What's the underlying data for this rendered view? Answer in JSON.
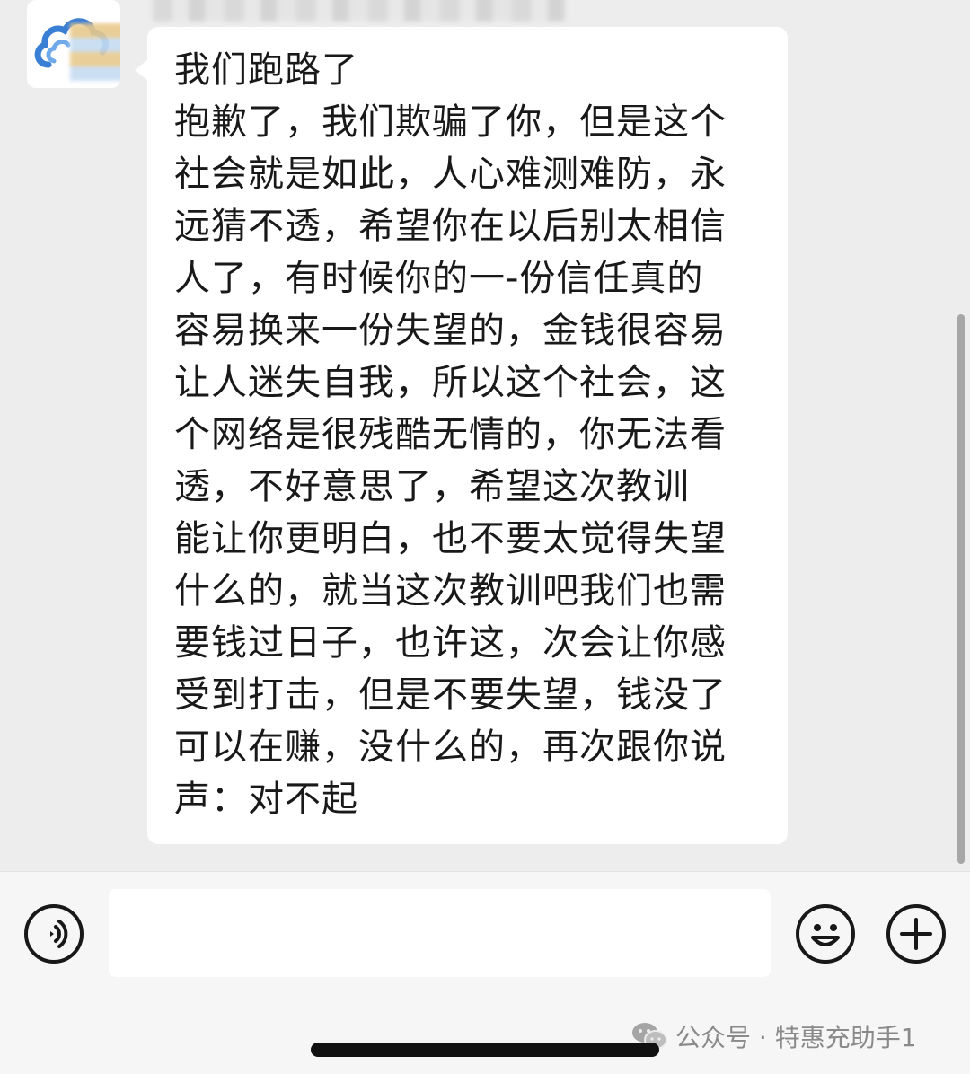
{
  "message": {
    "lines": [
      "我们跑路了",
      "抱歉了，我们欺骗了你，但是这个",
      "社会就是如此，人心难测难防，永",
      "远猜不透，希望你在以后别太相信",
      "人了，有时候你的一-份信任真的",
      "容易换来一份失望的，金钱很容易",
      "让人迷失自我，所以这个社会，这",
      "个网络是很残酷无情的，你无法看",
      "透，不好意思了，希望这次教训",
      "能让你更明白，也不要太觉得失望",
      "什么的，就当这次教训吧我们也需",
      "要钱过日子，也许这，次会让你感",
      "受到打击，但是不要失望，钱没了",
      "可以在赚，没什么的，再次跟你说",
      "声：对不起"
    ]
  },
  "input_bar": {
    "text_value": "",
    "voice_icon": "voice-icon",
    "emoji_icon": "emoji-icon",
    "plus_icon": "plus-icon"
  },
  "watermark": {
    "text": "公众号 · 特惠充助手1",
    "icon": "wechat-icon"
  },
  "colors": {
    "chat_background": "#ededed",
    "bubble": "#ffffff",
    "text": "#191919",
    "input_bar": "#f6f6f6"
  }
}
